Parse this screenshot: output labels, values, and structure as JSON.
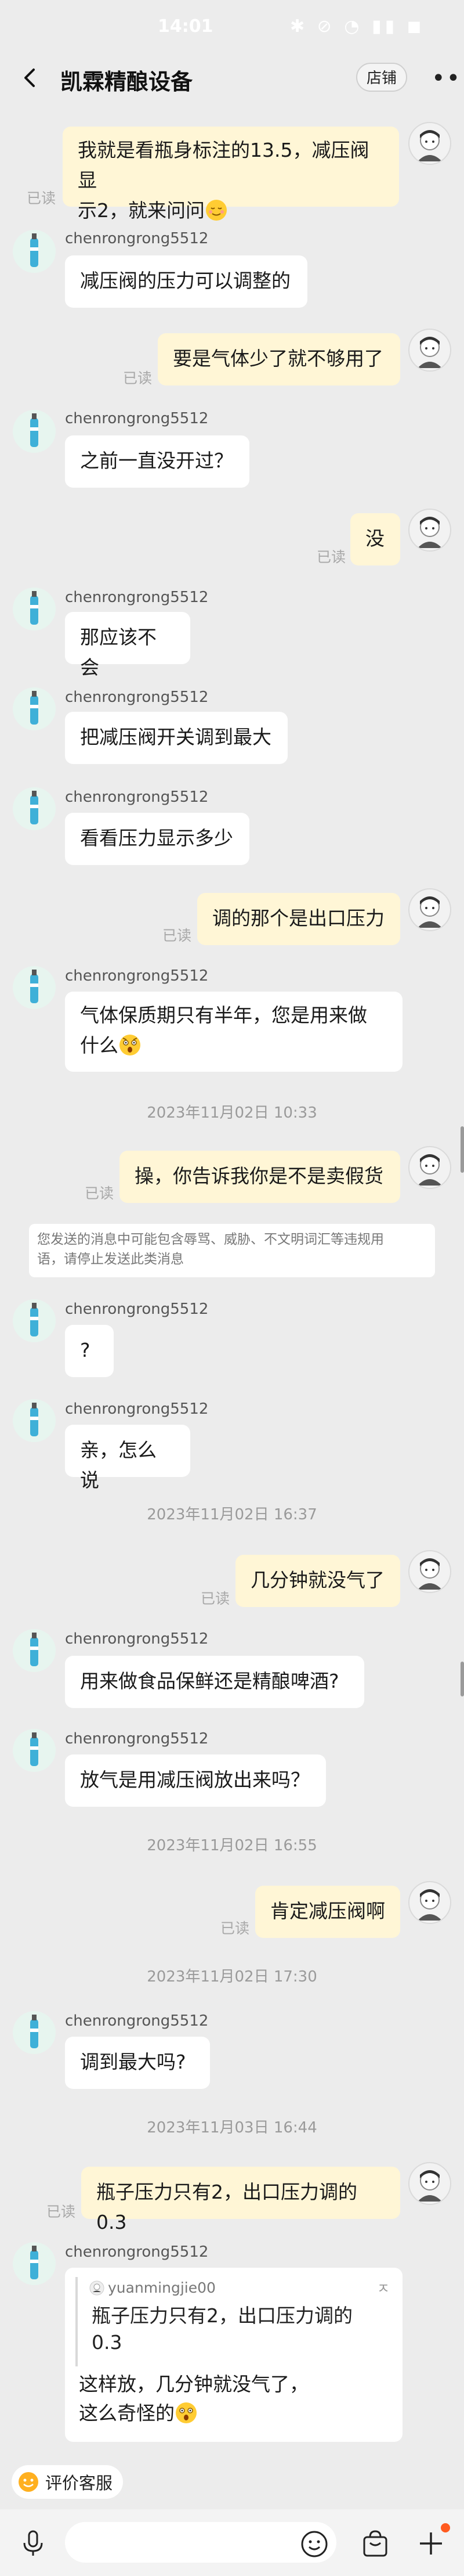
{
  "status_bar": {
    "time": "14:01",
    "icons": "✱ ⊘ ◔ ▮▮ ◼"
  },
  "header": {
    "title": "凯霖精酿设备",
    "shop_button": "店铺"
  },
  "messages": [
    {
      "from": "me",
      "lines": [
        "我就是看瓶身标注的13.5，减压阀显",
        "示2，就来问问"
      ],
      "emoji": "relieved-face-emoji",
      "read": "已读"
    },
    {
      "from": "them",
      "username": "chenrongrong5512",
      "text": "减压阀的压力可以调整的"
    },
    {
      "from": "me",
      "text": "要是气体少了就不够用了",
      "read": "已读"
    },
    {
      "from": "them",
      "username": "chenrongrong5512",
      "text": "之前一直没开过？"
    },
    {
      "from": "me",
      "text": "没",
      "read": "已读"
    },
    {
      "from": "them",
      "username": "chenrongrong5512",
      "text": "那应该不会"
    },
    {
      "from": "them",
      "username": "chenrongrong5512",
      "text": "把减压阀开关调到最大"
    },
    {
      "from": "them",
      "username": "chenrongrong5512",
      "text": "看看压力显示多少"
    },
    {
      "from": "me",
      "text": "调的那个是出口压力",
      "read": "已读"
    },
    {
      "from": "them",
      "username": "chenrongrong5512",
      "lines": [
        "气体保质期只有半年，您是用来做",
        "什么"
      ],
      "emoji": "shocked-face-emoji"
    },
    {
      "from": "me",
      "text": "操，你告诉我你是不是卖假货",
      "read": "已读"
    },
    {
      "from": "them",
      "username": "chenrongrong5512",
      "text": "?"
    },
    {
      "from": "them",
      "username": "chenrongrong5512",
      "text": "亲，怎么说"
    },
    {
      "from": "me",
      "text": "几分钟就没气了",
      "read": "已读"
    },
    {
      "from": "them",
      "username": "chenrongrong5512",
      "text": "用来做食品保鲜还是精酿啤酒?"
    },
    {
      "from": "them",
      "username": "chenrongrong5512",
      "text": "放气是用减压阀放出来吗？"
    },
    {
      "from": "me",
      "text": "肯定减压阀啊",
      "read": "已读"
    },
    {
      "from": "them",
      "username": "chenrongrong5512",
      "text": "调到最大吗?"
    },
    {
      "from": "me",
      "text": "瓶子压力只有2，出口压力调的0.3",
      "read": "已读"
    }
  ],
  "timestamps": [
    "2023年11月02日 10:33",
    "2023年11月02日 16:37",
    "2023年11月02日 16:55",
    "2023年11月02日 17:30",
    "2023年11月03日 16:44"
  ],
  "warning": {
    "line1": "您发送的消息中可能包含辱骂、威胁、不文明词汇等违规用",
    "line2": "语，请停止发送此类消息"
  },
  "quote_reply": {
    "username": "chenrongrong5512",
    "quoted_user": "yuanmingjie00",
    "quoted_line1": "瓶子压力只有2，出口压力调的",
    "quoted_line2": "0.3",
    "reply_line1": "这样放，几分钟就没气了，",
    "reply_line2": "这么奇怪的",
    "pin_icon": "ㅈ"
  },
  "rating_chip": {
    "label": "评价客服"
  },
  "colors": {
    "my_bubble": "#fff6d6",
    "their_bubble": "#ffffff",
    "background": "#ececec",
    "accent_dot": "#ff5a1f"
  }
}
